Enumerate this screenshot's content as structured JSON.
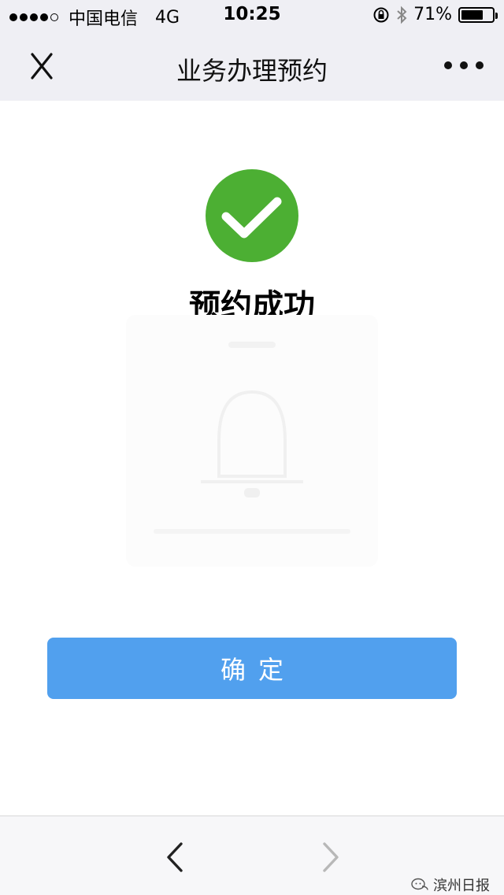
{
  "status_bar": {
    "carrier": "中国电信",
    "network": "4G",
    "time": "10:25",
    "battery_percent": "71%",
    "battery_level": 0.71,
    "signal_strength": 4,
    "signal_max": 5
  },
  "nav": {
    "title": "业务办理预约"
  },
  "result": {
    "message": "预约成功",
    "accent_color": "#4caf33"
  },
  "actions": {
    "confirm_label": "确定",
    "button_color": "#51a0ee"
  },
  "watermark": {
    "text": "滨州日报"
  }
}
